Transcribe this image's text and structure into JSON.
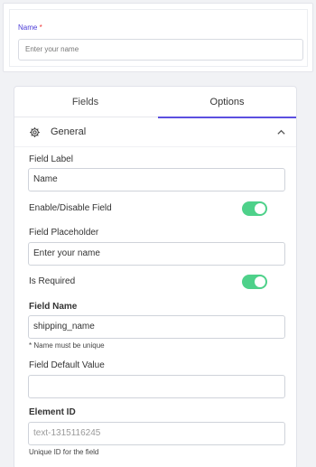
{
  "preview": {
    "label": "Name",
    "required_mark": "*",
    "placeholder": "Enter your name"
  },
  "tabs": [
    {
      "label": "Fields",
      "active": false
    },
    {
      "label": "Options",
      "active": true
    }
  ],
  "section": {
    "title": "General",
    "icon": "gear-icon",
    "toggle_icon": "chevron-up-icon"
  },
  "form": {
    "field_label": {
      "label": "Field Label",
      "value": "Name"
    },
    "enable_disable": {
      "label": "Enable/Disable Field",
      "enabled": true
    },
    "placeholder": {
      "label": "Field Placeholder",
      "value": "Enter your name"
    },
    "required": {
      "label": "Is Required",
      "enabled": true
    },
    "field_name": {
      "label": "Field Name",
      "value": "shipping_name",
      "hint": "* Name must be unique"
    },
    "default_value": {
      "label": "Field Default Value",
      "value": ""
    },
    "element_id": {
      "label": "Element ID",
      "placeholder": "text-1315116245",
      "hint": "Unique ID for the field"
    }
  },
  "colors": {
    "accent": "#5b4fe0",
    "toggle_on": "#4ed18a",
    "required": "#e33333"
  }
}
